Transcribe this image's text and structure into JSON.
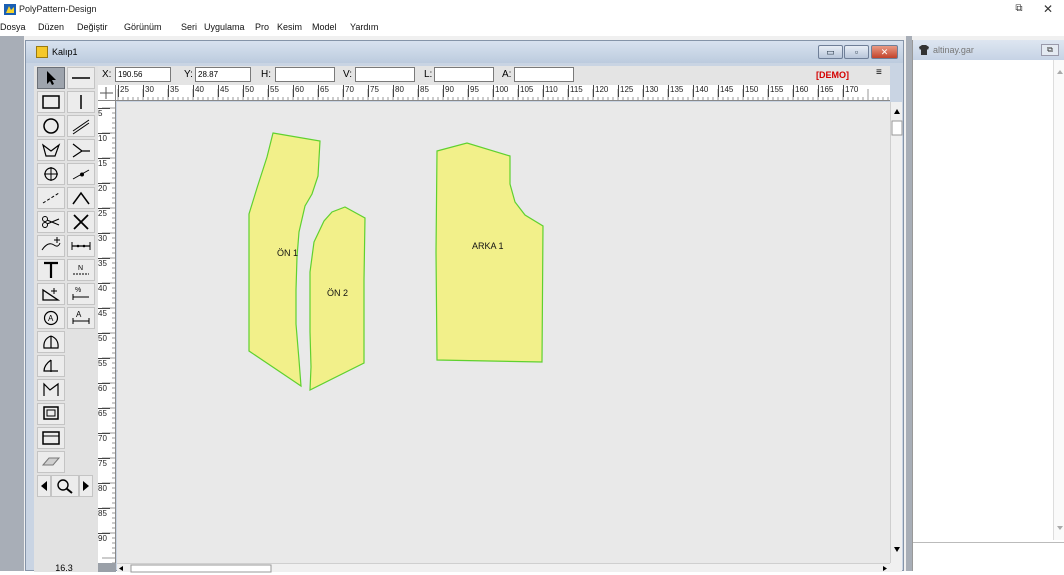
{
  "app": {
    "title": "PolyPattern-Design",
    "icon": "app-logo-icon",
    "restore_glyph": "⧉",
    "close_glyph": "✕"
  },
  "menu": [
    "Dosya",
    "Düzen",
    "Değiştir",
    "Görünüm",
    "Seri",
    "Uygulama",
    "Pro",
    "Kesim",
    "Model",
    "Yardım"
  ],
  "pattern_window": {
    "title": "Kalıp1",
    "controls": {
      "minimize": "▭",
      "maximize": "▫",
      "close": "✕"
    }
  },
  "coordinates": {
    "x_label": "X:",
    "x_value": "190.56",
    "y_label": "Y:",
    "y_value": "28.87",
    "h_label": "H:",
    "h_value": "",
    "v_label": "V:",
    "v_value": "",
    "l_label": "L:",
    "l_value": "",
    "a_label": "A:",
    "a_value": "",
    "demo": "[DEMO]",
    "menu_glyph": "≡"
  },
  "ruler": {
    "top": [
      "25",
      "30",
      "35",
      "40",
      "45",
      "50",
      "55",
      "60",
      "65",
      "70",
      "75",
      "80",
      "85",
      "90",
      "95",
      "100",
      "105",
      "110",
      "115",
      "120",
      "125",
      "130",
      "135",
      "140",
      "145",
      "150",
      "155",
      "160",
      "165",
      "170"
    ],
    "left": [
      "5",
      "10",
      "15",
      "20",
      "25",
      "30",
      "35",
      "40",
      "45",
      "50",
      "55",
      "60",
      "65",
      "70",
      "75",
      "80",
      "85",
      "90"
    ]
  },
  "tools": [
    "select-arrow-icon",
    "line-icon",
    "rectangle-icon",
    "vertical-line-icon",
    "circle-icon",
    "parallel-line-icon",
    "polygon-icon",
    "curve-icon",
    "crosshair-point-icon",
    "point-on-line-icon",
    "dashed-line-icon",
    "angle-icon",
    "scissors-icon",
    "cross-icon",
    "notch-icon",
    "measure-distance-icon",
    "text-icon",
    "piece-name-icon",
    "grain-angle-icon",
    "seam-allowance-icon",
    "rotate-piece-icon",
    "measure-text-icon",
    "mirror-icon",
    "half-mirror-icon",
    "fold-icon",
    "copy-piece-icon",
    "frame-icon",
    "eraser-icon",
    "scroll-left-icon",
    "zoom-icon",
    "scroll-right-icon"
  ],
  "zoom_value": "16.3",
  "pieces": [
    {
      "name": "ÖN 1"
    },
    {
      "name": "ÖN 2"
    },
    {
      "name": "ARKA 1"
    }
  ],
  "piece_fill": "#f2f08a",
  "piece_stroke": "#5fd12f",
  "side_panel": {
    "title": "altinay.gar",
    "close_glyph": "⧉"
  }
}
